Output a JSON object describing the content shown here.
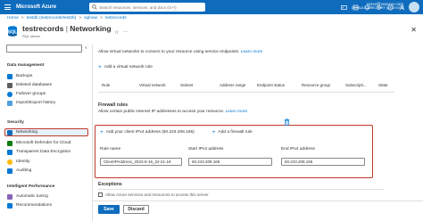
{
  "topbar": {
    "brand": "Microsoft Azure",
    "search_placeholder": "Search resources, services, and docs (G+/)",
    "account_user": "xxxxx@xxxxxxx.com",
    "account_directory": "DEFAULT DIRECTORY (XXXXXXX)"
  },
  "breadcrumb": [
    "Home",
    "testdb (testrecords/testdb)",
    "sqlnew",
    "testrecords"
  ],
  "header": {
    "title": "testrecords",
    "section": "Networking",
    "subtitle": "SQL server"
  },
  "sidebar": {
    "sections": [
      {
        "label": "Data management",
        "items": [
          "Backups",
          "Deleted databases",
          "Failover groups",
          "Import/Export history"
        ]
      },
      {
        "label": "Security",
        "items": [
          "Networking",
          "Microsoft Defender for Cloud",
          "Transparent Data Encryption",
          "Identity",
          "Auditing"
        ]
      },
      {
        "label": "Intelligent Performance",
        "items": [
          "Automatic tuning",
          "Recommendations"
        ]
      }
    ],
    "active_item": "Networking"
  },
  "main": {
    "vnet_description": "Allow virtual networks to connect to your resource using service endpoints.",
    "learn_more": "Learn more",
    "add_vnet_rule": "Add a virtual network rule",
    "table_headers": [
      "Rule",
      "Virtual network",
      "Subnet",
      "Address range",
      "Endpoint status",
      "Resource group",
      "Subscripti...",
      "State"
    ],
    "firewall_title": "Firewall rules",
    "firewall_description": "Allow certain public internet IP addresses to access your resource.",
    "add_client_ip": "Add your client IPv4 address (60.243.208.165)",
    "add_firewall_rule": "Add a firewall rule",
    "columns": {
      "rule_name": "Rule name",
      "start_ip": "Start IPv4 address",
      "end_ip": "End IPv4 address"
    },
    "rule": {
      "name": "ClientIPAddress_2023-9-16_22-21-18",
      "start_ip": "60.243.208.165",
      "end_ip": "60.243.208.165"
    },
    "exceptions_title": "Exceptions",
    "allow_azure": "Allow Azure services and resources to access this server"
  },
  "footer": {
    "save": "Save",
    "discard": "Discard"
  },
  "colors": {
    "azure_blue": "#0f6cbd",
    "link_blue": "#0078d4",
    "highlight_red": "#c0392b"
  }
}
